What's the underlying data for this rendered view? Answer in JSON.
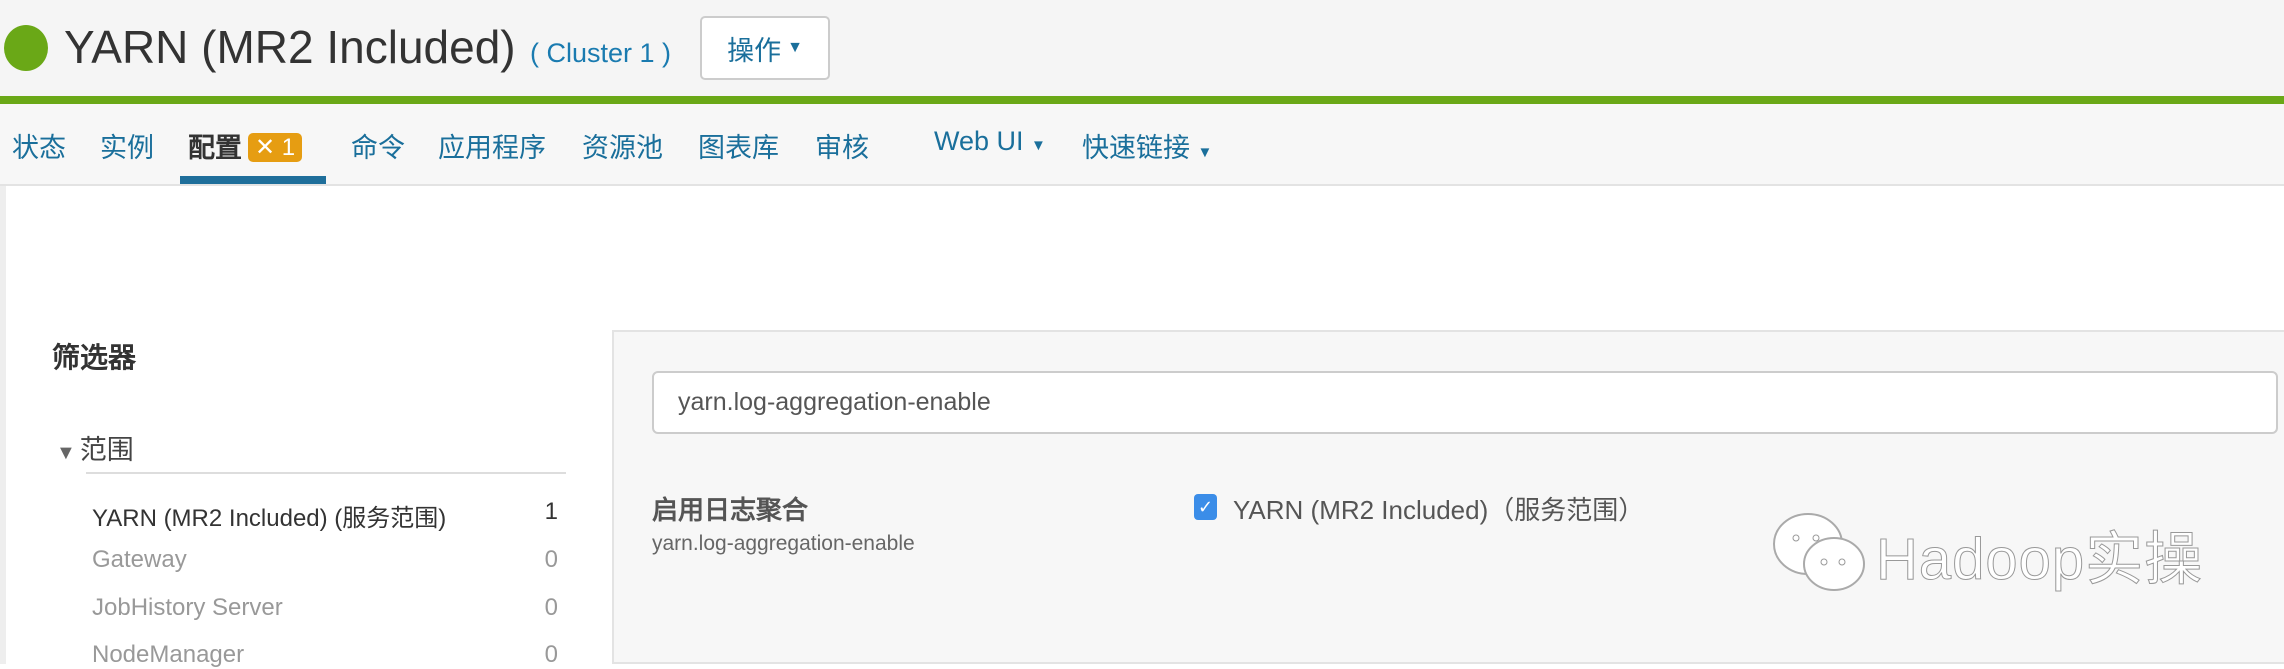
{
  "header": {
    "title": "YARN (MR2 Included)",
    "cluster": "( Cluster 1 )",
    "actions_label": "操作",
    "status_color": "#6aa817"
  },
  "nav": {
    "items": [
      "状态",
      "实例",
      "配置",
      "命令",
      "应用程序",
      "资源池",
      "图表库",
      "审核"
    ],
    "config_badge": "1",
    "webui": "Web UI",
    "quicklinks": "快速链接",
    "active": "配置"
  },
  "filter": {
    "title": "筛选器",
    "scope_label": "范围",
    "rows": [
      {
        "label": "YARN (MR2 Included) (服务范围)",
        "count": "1"
      },
      {
        "label": "Gateway",
        "count": "0"
      },
      {
        "label": "JobHistory Server",
        "count": "0"
      },
      {
        "label": "NodeManager",
        "count": "0"
      }
    ]
  },
  "main": {
    "search_value": "yarn.log-aggregation-enable",
    "property_label": "启用日志聚合",
    "property_key": "yarn.log-aggregation-enable",
    "checkbox_label": "YARN (MR2 Included)（服务范围）",
    "checked": true
  },
  "watermark": "Hadoop实操"
}
